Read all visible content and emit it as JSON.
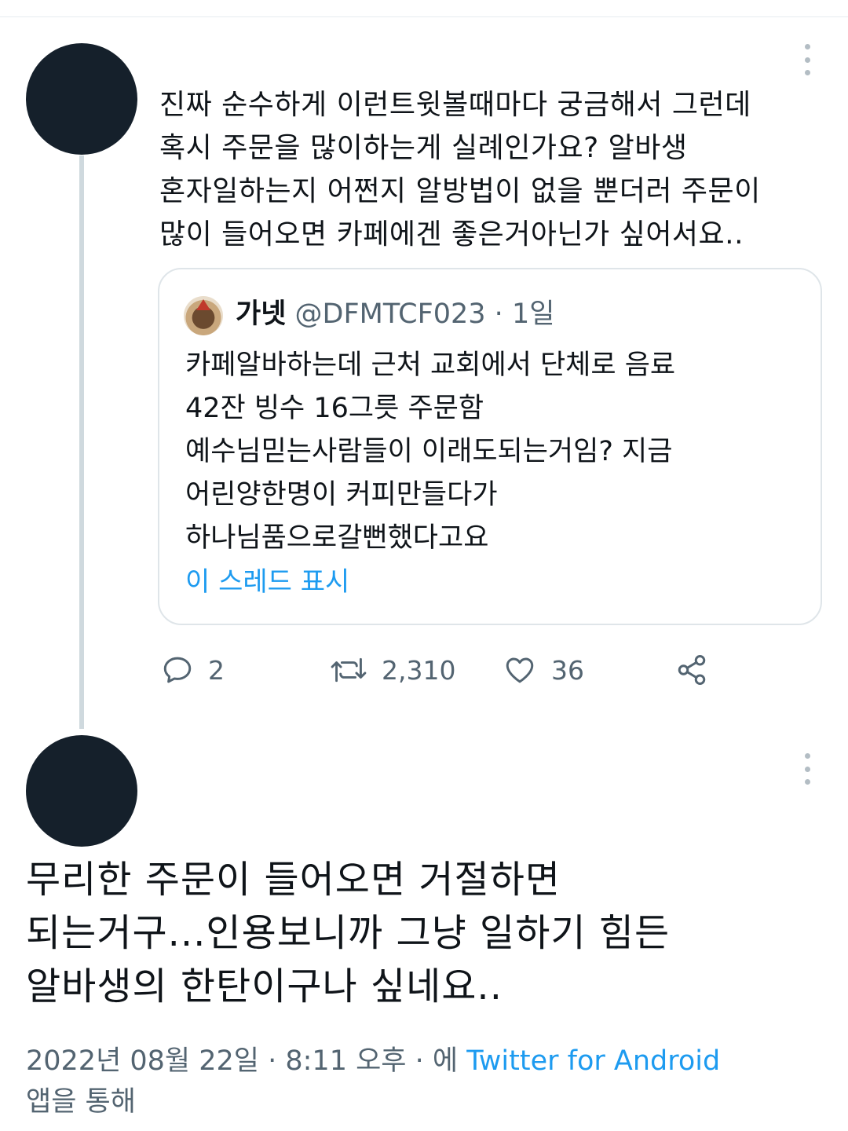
{
  "tweet1": {
    "text": "진짜 순수하게 이런트윗볼때마다 궁금해서 그런데\n혹시 주문을 많이하는게 실례인가요? 알바생\n혼자일하는지 어쩐지 알방법이 없을 뿐더러 주문이\n많이 들어오면 카페에겐 좋은거아닌가 싶어서요..",
    "quote": {
      "name": "가넷",
      "handle": "@DFMTCF023",
      "separator": "·",
      "time": "1일",
      "text": "카페알바하는데 근처 교회에서 단체로 음료\n42잔 빙수 16그릇 주문함\n예수님믿는사람들이 이래도되는거임? 지금\n어린양한명이 커피만들다가\n하나님품으로갈뻔했다고요",
      "show_thread": "이 스레드 표시"
    },
    "actions": {
      "reply_count": "2",
      "retweet_count": "2,310",
      "like_count": "36"
    }
  },
  "tweet2": {
    "text": "무리한 주문이 들어오면 거절하면\n되는거구...인용보니까 그냥 일하기 힘든\n알바생의 한탄이구나 싶네요..",
    "meta_datetime": "2022년 08월 22일 · 8:11 오후 · 에 ",
    "meta_source": "Twitter for Android",
    "meta_suffix": "\n앱을 통해"
  },
  "icons": [
    "more-icon",
    "reply-icon",
    "retweet-icon",
    "like-icon",
    "share-icon"
  ],
  "colors": {
    "link": "#1d9bf0",
    "muted": "#536471",
    "avatar": "#15202b"
  }
}
